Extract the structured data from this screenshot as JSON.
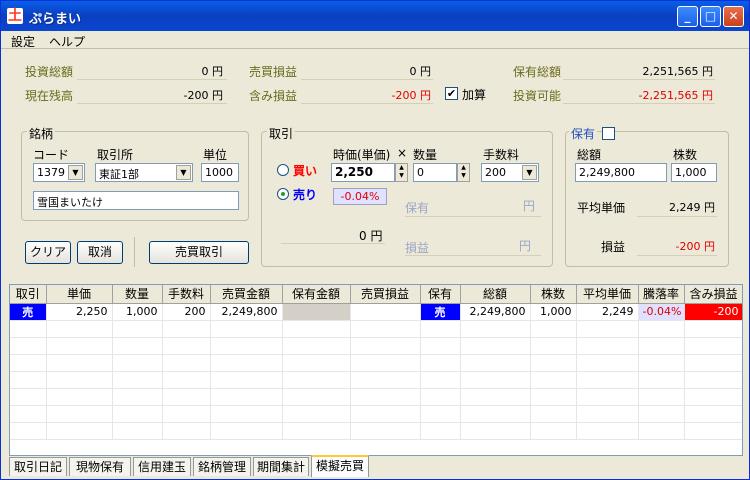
{
  "window": {
    "title": "ぷらまい"
  },
  "menu": {
    "settings": "設定",
    "help": "ヘルプ"
  },
  "summary": {
    "invest_total_label": "投資総額",
    "invest_total_value": "0 円",
    "trade_pl_label": "売買損益",
    "trade_pl_value": "0 円",
    "holding_total_label": "保有総額",
    "holding_total_value": "2,251,565 円",
    "balance_label": "現在残高",
    "balance_value": "-200 円",
    "unrealized_label": "含み損益",
    "unrealized_value": "-200 円",
    "add_label": "加算",
    "available_label": "投資可能",
    "available_value": "-2,251,565 円"
  },
  "brand": {
    "title": "銘柄",
    "code_label": "コード",
    "exchange_label": "取引所",
    "unit_label": "単位",
    "code_value": "1379",
    "exchange_value": "東証1部",
    "unit_value": "1000",
    "name_value": "雪国まいたけ",
    "clear_button": "クリア",
    "cancel_button": "取消",
    "trade_button": "売買取引"
  },
  "trade": {
    "title": "取引",
    "buy_label": "買い",
    "sell_label": "売り",
    "price_label": "時価(単価)",
    "times": "×",
    "qty_label": "数量",
    "fee_label": "手数料",
    "price_value": "2,250",
    "qty_value": "0",
    "fee_value": "200",
    "rate_value": "-0.04%",
    "amount_value": "0 円",
    "holding_label": "保有",
    "holding_unit": "円",
    "pl_label": "損益",
    "pl_unit": "円"
  },
  "holding": {
    "title": "保有",
    "total_label": "総額",
    "shares_label": "株数",
    "total_value": "2,249,800",
    "shares_value": "1,000",
    "avg_label": "平均単価",
    "avg_value": "2,249 円",
    "pl_label": "損益",
    "pl_value": "-200 円"
  },
  "grid": {
    "headers": [
      "取引",
      "単価",
      "数量",
      "手数料",
      "売買金額",
      "保有金額",
      "売買損益",
      "保有",
      "総額",
      "株数",
      "平均単価",
      "騰落率",
      "含み損益"
    ],
    "row": [
      "売",
      "2,250",
      "1,000",
      "200",
      "2,249,800",
      "",
      "",
      "売",
      "2,249,800",
      "1,000",
      "2,249",
      "-0.04%",
      "-200"
    ]
  },
  "tabs": [
    "取引日記",
    "現物保有",
    "信用建玉",
    "銘柄管理",
    "期間集計",
    "模擬売買"
  ]
}
